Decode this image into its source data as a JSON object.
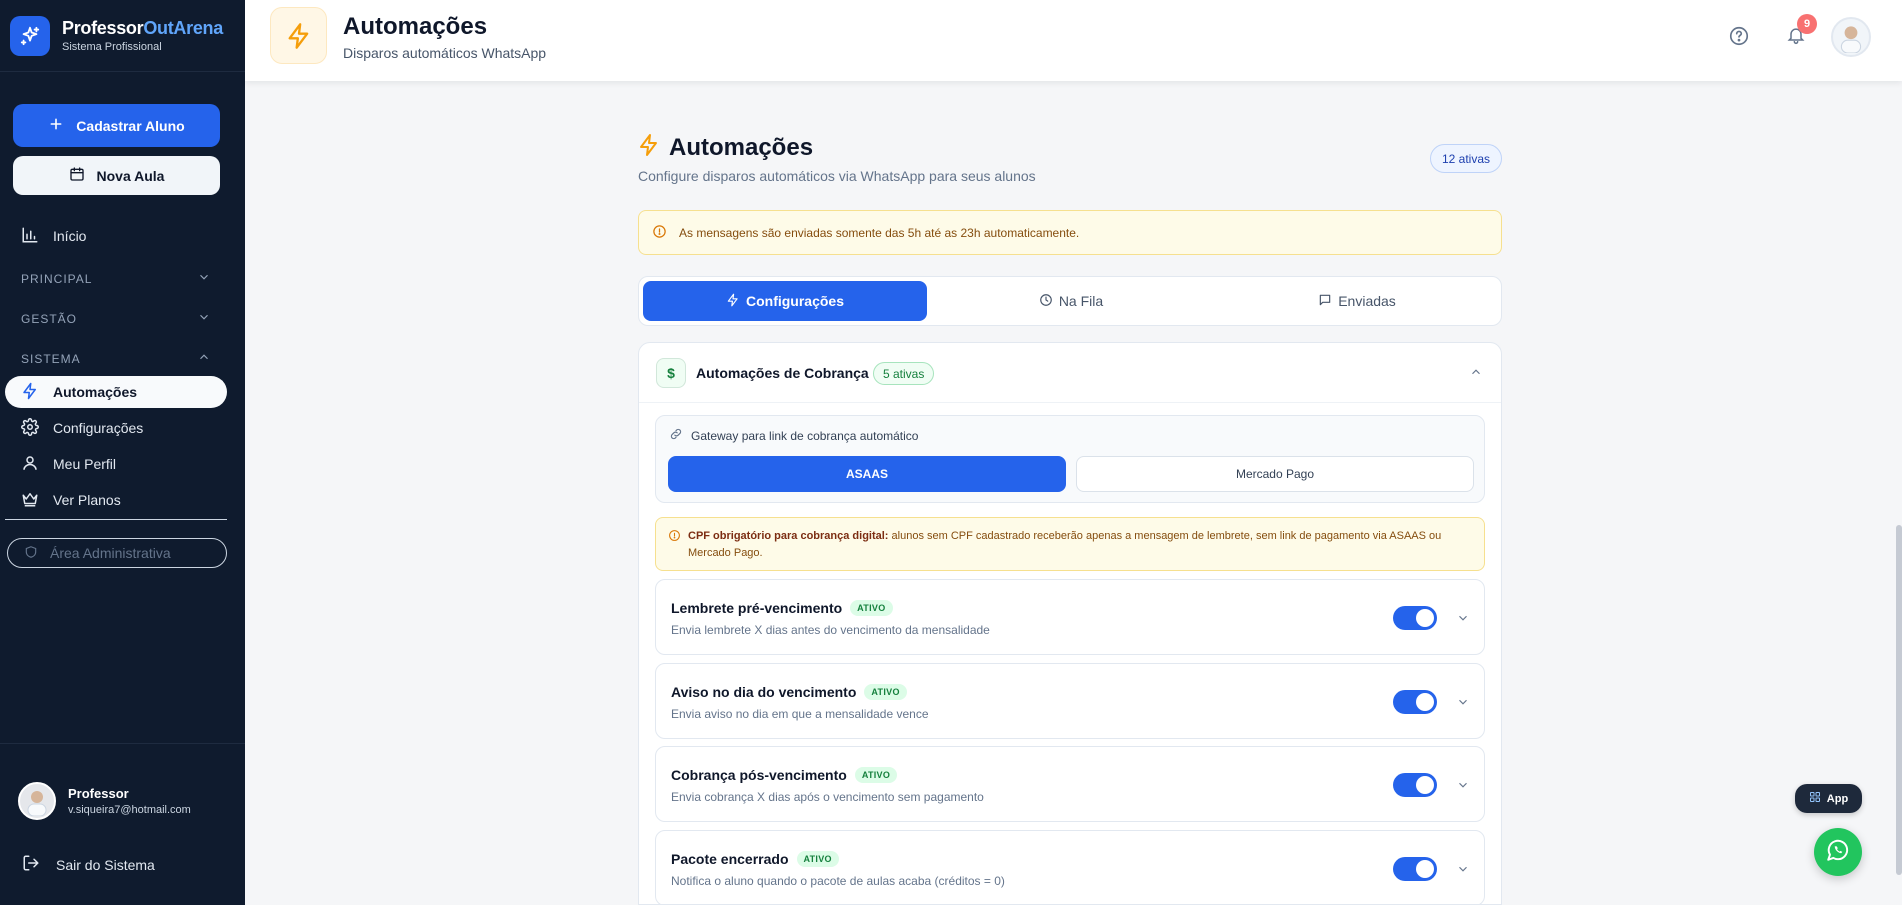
{
  "brand": {
    "name_main": "Professor",
    "name_highlight": "OutArena",
    "subtitle": "Sistema Profissional"
  },
  "sidebar": {
    "primary_button": "Cadastrar Aluno",
    "secondary_button": "Nova Aula",
    "home": "Início",
    "sections": {
      "principal": "PRINCIPAL",
      "gestao": "GESTÃO",
      "sistema": "SISTEMA"
    },
    "items": [
      {
        "label": "Automações",
        "icon": "zap-icon",
        "active": true
      },
      {
        "label": "Configurações",
        "icon": "gear-icon",
        "active": false
      },
      {
        "label": "Meu Perfil",
        "icon": "user-icon",
        "active": false
      },
      {
        "label": "Ver Planos",
        "icon": "crown-icon",
        "active": false
      }
    ],
    "admin_area": "Área Administrativa",
    "user": {
      "name": "Professor",
      "email": "v.siqueira7@hotmail.com"
    },
    "logout": "Sair do Sistema"
  },
  "header": {
    "title": "Automações",
    "subtitle": "Disparos automáticos WhatsApp",
    "notification_count": "9"
  },
  "main": {
    "title": "Automações",
    "subtitle": "Configure disparos automáticos via WhatsApp para seus alunos",
    "active_count": "12 ativas",
    "notice": "As mensagens são enviadas somente das 5h até as 23h automaticamente.",
    "tabs": [
      {
        "label": "Configurações",
        "icon": "zap-icon",
        "active": true
      },
      {
        "label": "Na Fila",
        "icon": "clock-icon",
        "active": false
      },
      {
        "label": "Enviadas",
        "icon": "message-icon",
        "active": false
      }
    ],
    "card": {
      "title": "Automações de Cobrança",
      "badge": "5 ativas",
      "gateway_label": "Gateway para link de cobrança automático",
      "gateway_options": [
        "ASAAS",
        "Mercado Pago"
      ],
      "gateway_selected": "ASAAS",
      "cpf_bold": "CPF obrigatório para cobrança digital:",
      "cpf_text": " alunos sem CPF cadastrado receberão apenas a mensagem de lembrete, sem link de pagamento via ASAAS ou Mercado Pago.",
      "automations": [
        {
          "title": "Lembrete pré-vencimento",
          "badge": "ATIVO",
          "desc": "Envia lembrete X dias antes do vencimento da mensalidade",
          "enabled": true
        },
        {
          "title": "Aviso no dia do vencimento",
          "badge": "ATIVO",
          "desc": "Envia aviso no dia em que a mensalidade vence",
          "enabled": true
        },
        {
          "title": "Cobrança pós-vencimento",
          "badge": "ATIVO",
          "desc": "Envia cobrança X dias após o vencimento sem pagamento",
          "enabled": true
        },
        {
          "title": "Pacote encerrado",
          "badge": "ATIVO",
          "desc": "Notifica o aluno quando o pacote de aulas acaba (créditos = 0)",
          "enabled": true
        }
      ]
    }
  },
  "floating": {
    "app_label": "App"
  },
  "colors": {
    "accent": "#2563eb",
    "sidebar_bg": "#0f1b2e",
    "success": "#15803d",
    "warning_bg": "#fefbe8",
    "whatsapp": "#22c55e"
  }
}
